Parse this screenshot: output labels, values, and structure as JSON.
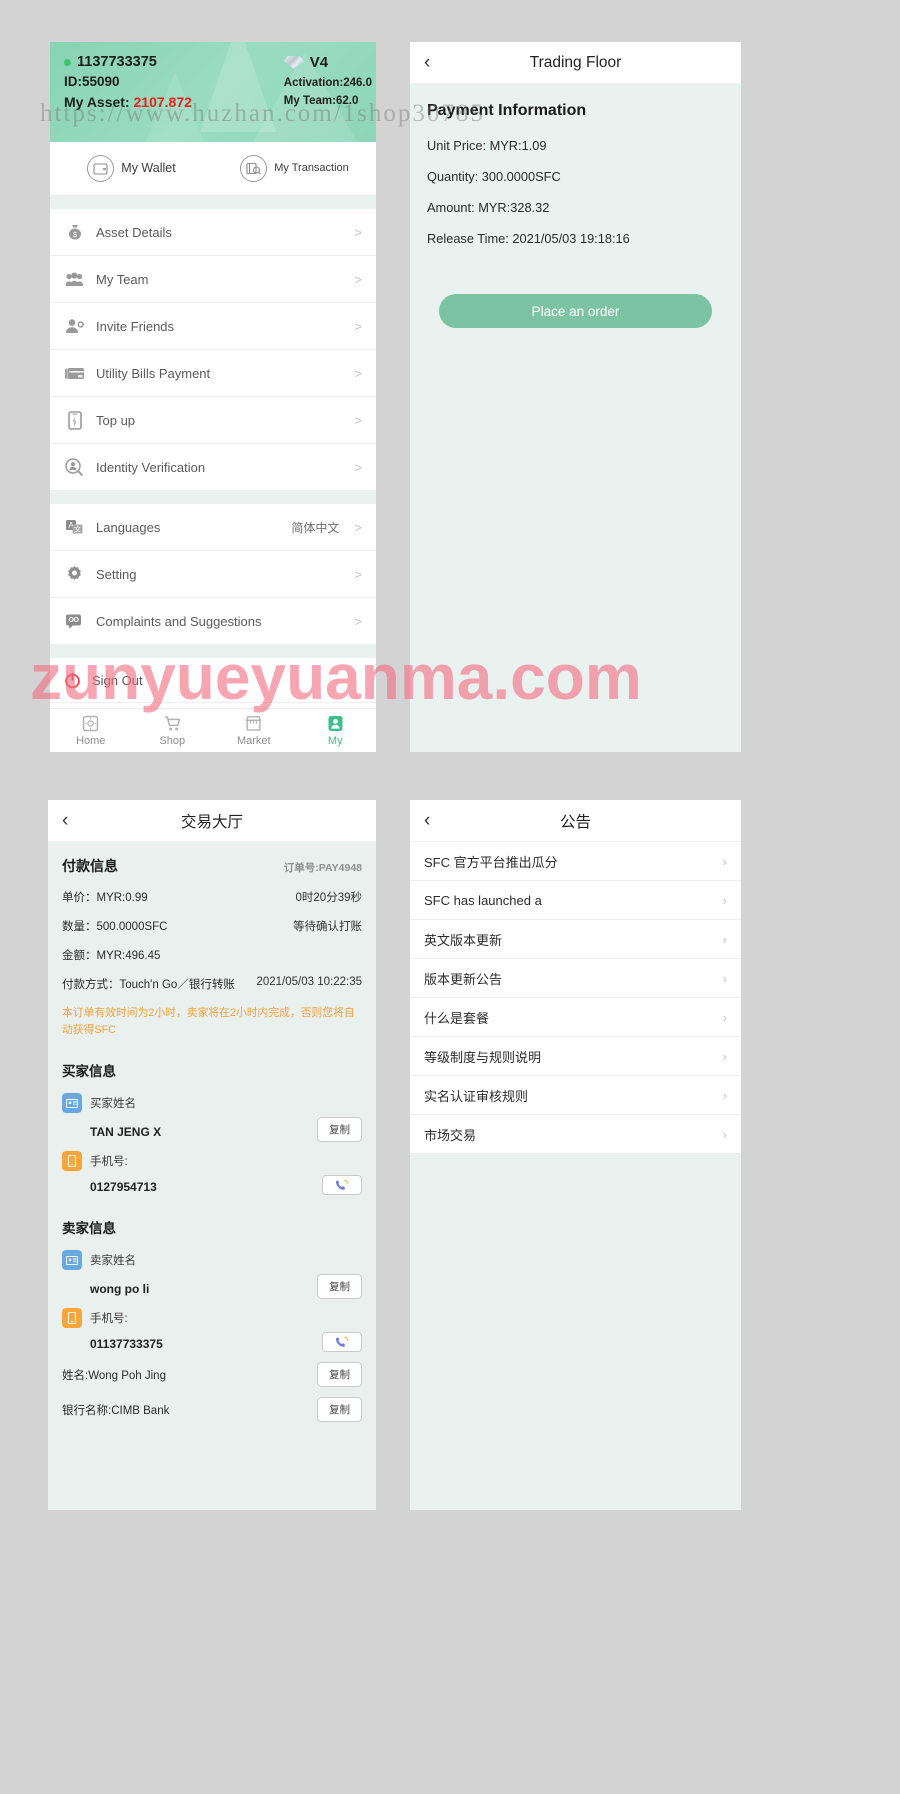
{
  "watermarks": {
    "url": "https://www.huzhan.com/1shop30785",
    "brand": "zunyueyuanma.com"
  },
  "panel1": {
    "name": "profile-page",
    "hero": {
      "username": "1137733375",
      "id": "ID:55090",
      "asset_label": "My Asset:",
      "asset_value": "2107.872",
      "level": "V4",
      "activation": "Activation:246.0",
      "my_team": "My Team:62.0",
      "status_dot_color": "#3ec46d",
      "asset_color": "#e8221b",
      "gradient_from": "#88d3b4",
      "gradient_to": "#8ed6b8"
    },
    "quick": [
      {
        "label": "My Wallet",
        "icon": "wallet-icon"
      },
      {
        "label": "My Transaction",
        "icon": "transaction-icon"
      }
    ],
    "menu": [
      {
        "label": "Asset Details",
        "icon": "money-bag-icon",
        "value": "",
        "chevron": ">"
      },
      {
        "label": "My Team",
        "icon": "team-icon",
        "value": "",
        "chevron": ">"
      },
      {
        "label": "Invite Friends",
        "icon": "invite-friends-icon",
        "value": "",
        "chevron": ">"
      },
      {
        "label": "Utility Bills Payment",
        "icon": "bills-card-icon",
        "value": "",
        "chevron": ">"
      },
      {
        "label": "Top up",
        "icon": "topup-phone-icon",
        "value": "",
        "chevron": ">"
      },
      {
        "label": "Identity Verification",
        "icon": "identity-verification-icon",
        "value": "",
        "chevron": ">"
      }
    ],
    "menu2": [
      {
        "label": "Languages",
        "icon": "languages-icon",
        "value": "简体中文",
        "chevron": ">"
      },
      {
        "label": "Setting",
        "icon": "gear-icon",
        "value": "",
        "chevron": ">"
      },
      {
        "label": "Complaints and Suggestions",
        "icon": "feedback-icon",
        "value": "",
        "chevron": ">"
      }
    ],
    "signout": {
      "label": "Sign Out",
      "icon": "power-icon"
    },
    "tabs": [
      {
        "label": "Home",
        "icon": "home-icon",
        "active": false
      },
      {
        "label": "Shop",
        "icon": "cart-icon",
        "active": false
      },
      {
        "label": "Market",
        "icon": "market-icon",
        "active": false
      },
      {
        "label": "My",
        "icon": "user-icon",
        "active": true
      }
    ],
    "accent": "#3fbe8c"
  },
  "panel2": {
    "name": "trading-floor-page",
    "nav": {
      "back": "‹",
      "title": "Trading Floor"
    },
    "heading": "Payment Information",
    "lines": [
      "Unit Price: MYR:1.09",
      "Quantity: 300.0000SFC",
      "Amount: MYR:328.32",
      "Release Time: 2021/05/03 19:18:16"
    ],
    "button": "Place an order",
    "button_color": "#7cc3a3"
  },
  "panel3": {
    "name": "trading-hall-page-cn",
    "nav": {
      "back": "‹",
      "title": "交易大厅"
    },
    "section_title": "付款信息",
    "order_no": "订单号:PAY4948",
    "rows": [
      {
        "left": "单价：MYR:0.99",
        "right": "0时20分39秒"
      },
      {
        "left": "数量：500.0000SFC",
        "right": "等待确认打账"
      },
      {
        "left": "金额：MYR:496.45",
        "right": ""
      },
      {
        "left": "付款方式：Touch'n Go／银行转账",
        "right": "2021/05/03 10:22:35"
      }
    ],
    "note": "本订单有效时间为2小时，卖家将在2小时内完成，否则您将自动获得SFC",
    "buyer": {
      "title": "买家信息",
      "name_label": "买家姓名",
      "name_value": "TAN JENG X",
      "name_action": "复制",
      "phone_label": "手机号:",
      "phone_value": "0127954713",
      "phone_action": "call-icon"
    },
    "seller": {
      "title": "卖家信息",
      "name_label": "卖家姓名",
      "name_value": "wong po li",
      "name_action": "复制",
      "phone_label": "手机号:",
      "phone_value": "01137733375",
      "phone_action": "call-icon",
      "extra": [
        {
          "label": "姓名:Wong Poh Jing",
          "action": "复制"
        },
        {
          "label": "银行名称:CIMB Bank",
          "action": "复制"
        }
      ]
    },
    "note_color": "#f0a13c"
  },
  "panel4": {
    "name": "announcements-page",
    "nav": {
      "back": "‹",
      "title": "公告"
    },
    "items": [
      "SFC 官方平台推出瓜分",
      "SFC has launched a",
      "英文版本更新",
      "版本更新公告",
      "什么是套餐",
      "等级制度与规则说明",
      "实名认证审核规则",
      "市场交易"
    ],
    "chevron": "›"
  }
}
